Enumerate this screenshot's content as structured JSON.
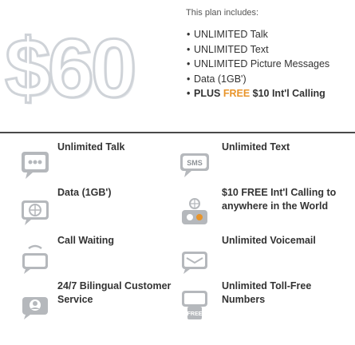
{
  "plan": {
    "price": "$60",
    "includes_title": "This plan includes:",
    "features": [
      {
        "bullet": "•",
        "text": "UNLIMITED Talk"
      },
      {
        "bullet": "•",
        "text": "UNLIMITED Text"
      },
      {
        "bullet": "•",
        "text": "UNLIMITED Picture Messages"
      },
      {
        "bullet": "•",
        "text": "Data (1GB')"
      }
    ],
    "highlight": {
      "bullet": "•",
      "prefix": "PLUS ",
      "free": "FREE",
      "suffix": " $10 Int'l Calling"
    }
  },
  "features": {
    "unlimited_talk": "Unlimited Talk",
    "unlimited_text": "Unlimited Text",
    "data": "Data (1GB')",
    "intl_calling": "$10 FREE Int'l Calling to anywhere in the World",
    "call_waiting": "Call Waiting",
    "voicemail": "Unlimited Voicemail",
    "customer_service": "24/7 Bilingual Customer Service",
    "toll_free": "Unlimited Toll-Free Numbers"
  },
  "icons": {
    "sms_badge": "SMS",
    "free_badge": "FREE"
  },
  "colors": {
    "icon_gray": "#b5b8bc",
    "icon_dark": "#8d9196",
    "accent_orange": "#e8942a",
    "divider": "#4a4a4a"
  }
}
